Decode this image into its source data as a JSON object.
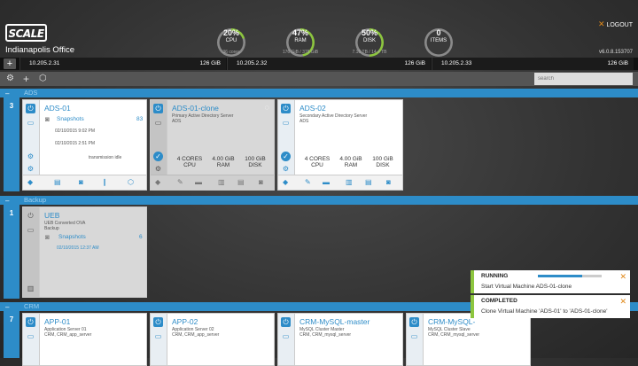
{
  "header": {
    "logo_text": "SCALE",
    "office": "Indianapolis Office",
    "logout": "LOGOUT",
    "version": "v6.0.8.153707",
    "gauges": [
      {
        "pct": "20%",
        "label": "CPU",
        "sub": "36 cores",
        "level": 0.2,
        "color": "#8dc63f"
      },
      {
        "pct": "47%",
        "label": "RAM",
        "sub": "176 GiB / 378 GiB",
        "level": 0.47,
        "color": "#8dc63f"
      },
      {
        "pct": "50%",
        "label": "DISK",
        "sub": "7.16 TB / 14.4 TB",
        "level": 0.5,
        "color": "#8dc63f"
      },
      {
        "pct": "0",
        "label": "ITEMS",
        "sub": "",
        "level": 0,
        "color": "#8dc63f"
      }
    ]
  },
  "nodes": [
    {
      "ip": "10.205.2.31",
      "mem": "126 GiB"
    },
    {
      "ip": "10.205.2.32",
      "mem": "126 GiB"
    },
    {
      "ip": "10.205.2.33",
      "mem": "126 GiB"
    },
    {
      "ip": "",
      "mem": "126 GiB"
    }
  ],
  "toolbar": {
    "search_placeholder": "search",
    "icons": [
      "gear-icon",
      "plus-icon",
      "cube-icon"
    ]
  },
  "groups": [
    {
      "name": "ADS",
      "count": "3"
    },
    {
      "name": "Backup",
      "count": "1"
    },
    {
      "name": "CRM",
      "count": "7"
    }
  ],
  "vms": {
    "ads01": {
      "name": "ADS-01",
      "snapshots_label": "Snapshots",
      "snapshots_count": "83",
      "snap_time1": "02/10/2015 9:02 PM",
      "snap_time2": "02/10/2015 2:51 PM",
      "status": "transmission idle"
    },
    "ads01clone": {
      "name": "ADS-01-clone",
      "desc1": "Primary Active Directory Server",
      "desc2": "ADS",
      "cpu": "4 CORES",
      "cpu_l": "CPU",
      "ram": "4.00 GiB",
      "ram_l": "RAM",
      "disk": "100 GiB",
      "disk_l": "DISK"
    },
    "ads02": {
      "name": "ADS-02",
      "desc1": "Secondary Active Directory Server",
      "desc2": "ADS",
      "cpu": "4 CORES",
      "cpu_l": "CPU",
      "ram": "4.00 GiB",
      "ram_l": "RAM",
      "disk": "100 GiB",
      "disk_l": "DISK"
    },
    "ueb": {
      "name": "UEB",
      "desc1": "UEB Converted OVA",
      "desc2": "Backup",
      "snapshots_label": "Snapshots",
      "snapshots_count": "6",
      "snap_time": "02/10/2015 12:37 AM"
    },
    "app01": {
      "name": "APP-01",
      "desc1": "Application Server 01",
      "desc2": "CRM, CRM_app_server"
    },
    "app02": {
      "name": "APP-02",
      "desc1": "Application Server 02",
      "desc2": "CRM, CRM_app_server"
    },
    "crmmaster": {
      "name": "CRM-MySQL-master",
      "desc1": "MySQL Cluster Master",
      "desc2": "CRM, CRM_mysql_server"
    },
    "crmslave": {
      "name": "CRM-MySQL-",
      "desc1": "MySQL Cluster Slave",
      "desc2": "CRM, CRM_mysql_server"
    }
  },
  "notifications": [
    {
      "title": "RUNNING",
      "text": "Start Virtual Machine ADS-01-clone",
      "progress": 0.7
    },
    {
      "title": "COMPLETED",
      "text": "Clone Virtual Machine 'ADS-01' to 'ADS-01-clone'"
    }
  ],
  "colors": {
    "accent": "#2d8cc8",
    "gauge": "#8dc63f",
    "close": "#e0891a"
  }
}
